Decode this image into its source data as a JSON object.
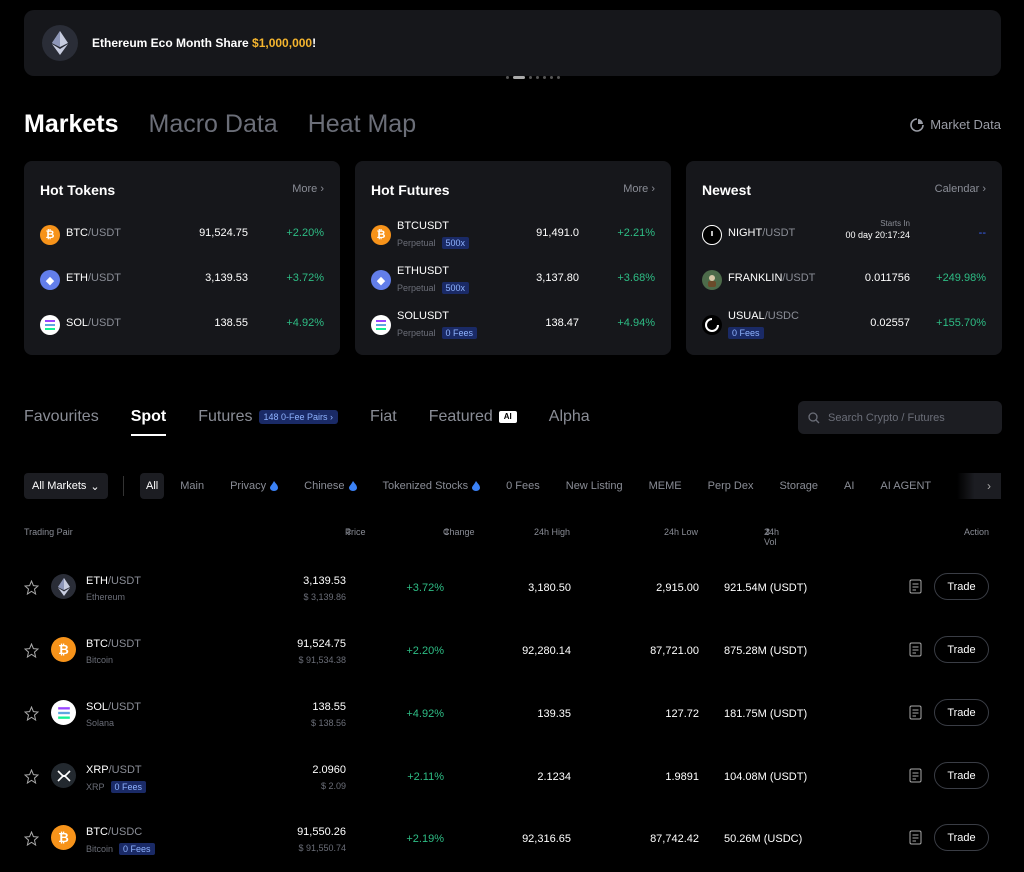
{
  "banner": {
    "text": "Ethereum Eco Month Share ",
    "highlight": "$1,000,000",
    "suffix": "!"
  },
  "top_tabs": [
    "Markets",
    "Macro Data",
    "Heat Map"
  ],
  "market_data_label": "Market Data",
  "cards": {
    "hot_tokens": {
      "title": "Hot Tokens",
      "more": "More",
      "rows": [
        {
          "base": "BTC",
          "quote": "/USDT",
          "price": "91,524.75",
          "change": "+2.20%"
        },
        {
          "base": "ETH",
          "quote": "/USDT",
          "price": "3,139.53",
          "change": "+3.72%"
        },
        {
          "base": "SOL",
          "quote": "/USDT",
          "price": "138.55",
          "change": "+4.92%"
        }
      ]
    },
    "hot_futures": {
      "title": "Hot Futures",
      "more": "More",
      "rows": [
        {
          "symbol": "BTCUSDT",
          "sub": "Perpetual",
          "badge": "500x",
          "price": "91,491.0",
          "change": "+2.21%"
        },
        {
          "symbol": "ETHUSDT",
          "sub": "Perpetual",
          "badge": "500x",
          "price": "3,137.80",
          "change": "+3.68%"
        },
        {
          "symbol": "SOLUSDT",
          "sub": "Perpetual",
          "badge": "0 Fees",
          "price": "138.47",
          "change": "+4.94%"
        }
      ]
    },
    "newest": {
      "title": "Newest",
      "more": "Calendar",
      "rows": [
        {
          "base": "NIGHT",
          "quote": "/USDT",
          "starts_label": "Starts In",
          "starts_value": "00 day 20:17:24",
          "change": "--"
        },
        {
          "base": "FRANKLIN",
          "quote": "/USDT",
          "price": "0.011756",
          "change": "+249.98%"
        },
        {
          "base": "USUAL",
          "quote": "/USDC",
          "badge": "0 Fees",
          "price": "0.02557",
          "change": "+155.70%"
        }
      ]
    }
  },
  "category_tabs": {
    "favourites": "Favourites",
    "spot": "Spot",
    "futures": "Futures",
    "futures_pill": "148 0-Fee Pairs",
    "fiat": "Fiat",
    "featured": "Featured",
    "featured_icon": "AI",
    "alpha": "Alpha"
  },
  "search": {
    "placeholder": "Search Crypto / Futures"
  },
  "filters": {
    "all_markets": "All Markets",
    "chips": [
      "All",
      "Main",
      "Privacy",
      "Chinese",
      "Tokenized Stocks",
      "0 Fees",
      "New Listing",
      "MEME",
      "Perp Dex",
      "Storage",
      "AI",
      "AI AGENT"
    ]
  },
  "table": {
    "headers": {
      "pair": "Trading Pair",
      "price": "Price",
      "change": "Change",
      "high": "24h High",
      "low": "24h Low",
      "vol": "24h Vol",
      "action": "Action"
    },
    "trade_label": "Trade",
    "rows": [
      {
        "base": "ETH",
        "quote": "/USDT",
        "name": "Ethereum",
        "price": "3,139.53",
        "usd": "$ 3,139.86",
        "change": "+3.72%",
        "high": "3,180.50",
        "low": "2,915.00",
        "vol": "921.54M (USDT)"
      },
      {
        "base": "BTC",
        "quote": "/USDT",
        "name": "Bitcoin",
        "price": "91,524.75",
        "usd": "$ 91,534.38",
        "change": "+2.20%",
        "high": "92,280.14",
        "low": "87,721.00",
        "vol": "875.28M (USDT)"
      },
      {
        "base": "SOL",
        "quote": "/USDT",
        "name": "Solana",
        "price": "138.55",
        "usd": "$ 138.56",
        "change": "+4.92%",
        "high": "139.35",
        "low": "127.72",
        "vol": "181.75M (USDT)"
      },
      {
        "base": "XRP",
        "quote": "/USDT",
        "name": "XRP",
        "badge": "0 Fees",
        "price": "2.0960",
        "usd": "$ 2.09",
        "change": "+2.11%",
        "high": "2.1234",
        "low": "1.9891",
        "vol": "104.08M (USDT)"
      },
      {
        "base": "BTC",
        "quote": "/USDC",
        "name": "Bitcoin",
        "badge": "0 Fees",
        "price": "91,550.26",
        "usd": "$ 91,550.74",
        "change": "+2.19%",
        "high": "92,316.65",
        "low": "87,742.42",
        "vol": "50.26M (USDC)"
      }
    ]
  },
  "colors": {
    "up": "#2ebd85",
    "accent": "#f5b52e",
    "badge_bg": "#1a2a66"
  }
}
